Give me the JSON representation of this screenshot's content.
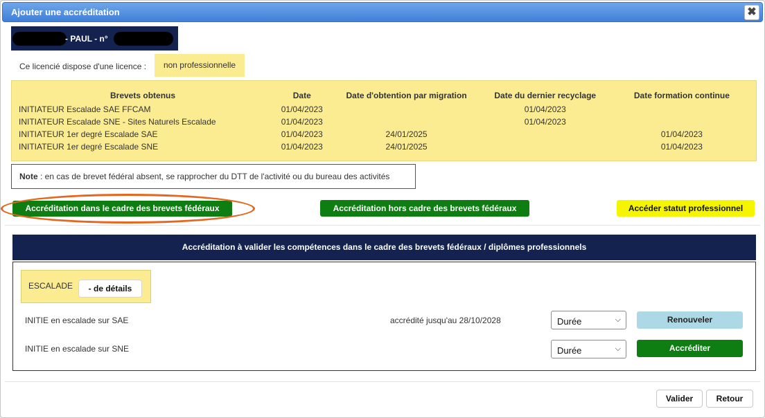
{
  "window": {
    "title": "Ajouter une accréditation",
    "close_glyph": "✖"
  },
  "member": {
    "name_visible": "- PAUL - n°"
  },
  "licence": {
    "label": "Ce licencié dispose d'une licence :",
    "value": "non professionnelle"
  },
  "brevets": {
    "headers": [
      "Brevets obtenus",
      "Date",
      "Date d'obtention par migration",
      "Date du dernier recyclage",
      "Date formation continue"
    ],
    "rows": [
      [
        "INITIATEUR Escalade SAE FFCAM",
        "01/04/2023",
        "",
        "01/04/2023",
        ""
      ],
      [
        "INITIATEUR Escalade SNE - Sites Naturels Escalade",
        "01/04/2023",
        "",
        "01/04/2023",
        ""
      ],
      [
        "INITIATEUR 1er degré Escalade SAE",
        "01/04/2023",
        "24/01/2025",
        "",
        "01/04/2023"
      ],
      [
        "INITIATEUR 1er degré Escalade SNE",
        "01/04/2023",
        "24/01/2025",
        "",
        "01/04/2023"
      ]
    ]
  },
  "note": {
    "bold": "Note",
    "text": " : en cas de brevet fédéral absent, se rapprocher du DTT de l'activité ou du bureau des activités"
  },
  "actions": {
    "in_frame": "Accréditation dans le cadre des brevets fédéraux",
    "out_frame": "Accréditation hors cadre des brevets fédéraux",
    "pro_status": "Accéder statut professionnel"
  },
  "panel": {
    "title": "Accréditation à valider les compétences dans le cadre des brevets fédéraux / diplômes professionnels",
    "activity": "ESCALADE",
    "details_button": "- de détails",
    "rows": [
      {
        "label": "INITIE en escalade sur SAE",
        "status": "accrédité jusqu'au 28/10/2028",
        "select": "Durée",
        "button": "Renouveler"
      },
      {
        "label": "INITIE en escalade sur SNE",
        "status": "",
        "select": "Durée",
        "button": "Accréditer"
      }
    ]
  },
  "footer": {
    "validate": "Valider",
    "back": "Retour"
  },
  "colors": {
    "navy": "#13224f",
    "yellow_bg": "#fbec92",
    "green": "#0e7d12",
    "yellow_button": "#f5f500",
    "light_blue": "#add8e6",
    "highlight_oval": "#e4661f"
  }
}
